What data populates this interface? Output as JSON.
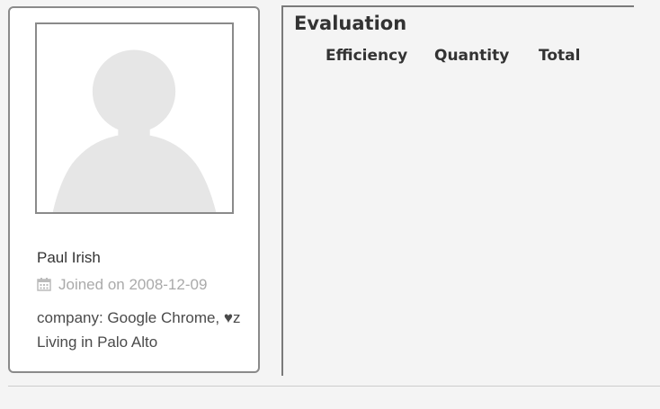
{
  "profile": {
    "avatar_icon": "default-user-silhouette-icon",
    "name": "Paul Irish",
    "joined_icon": "calendar-icon",
    "joined_text": "Joined on 2008-12-09",
    "company": "company: Google Chrome, ♥z",
    "location": "Living in Palo Alto"
  },
  "evaluation": {
    "title": "Evaluation",
    "columns": [
      "Efficiency",
      "Quantity",
      "Total"
    ]
  },
  "colors": {
    "background": "#f4f4f4",
    "card_border": "#8a8a8a",
    "silhouette": "#e6e6e6",
    "muted_text": "#aaaaaa",
    "body_text": "#4a4a4a"
  }
}
